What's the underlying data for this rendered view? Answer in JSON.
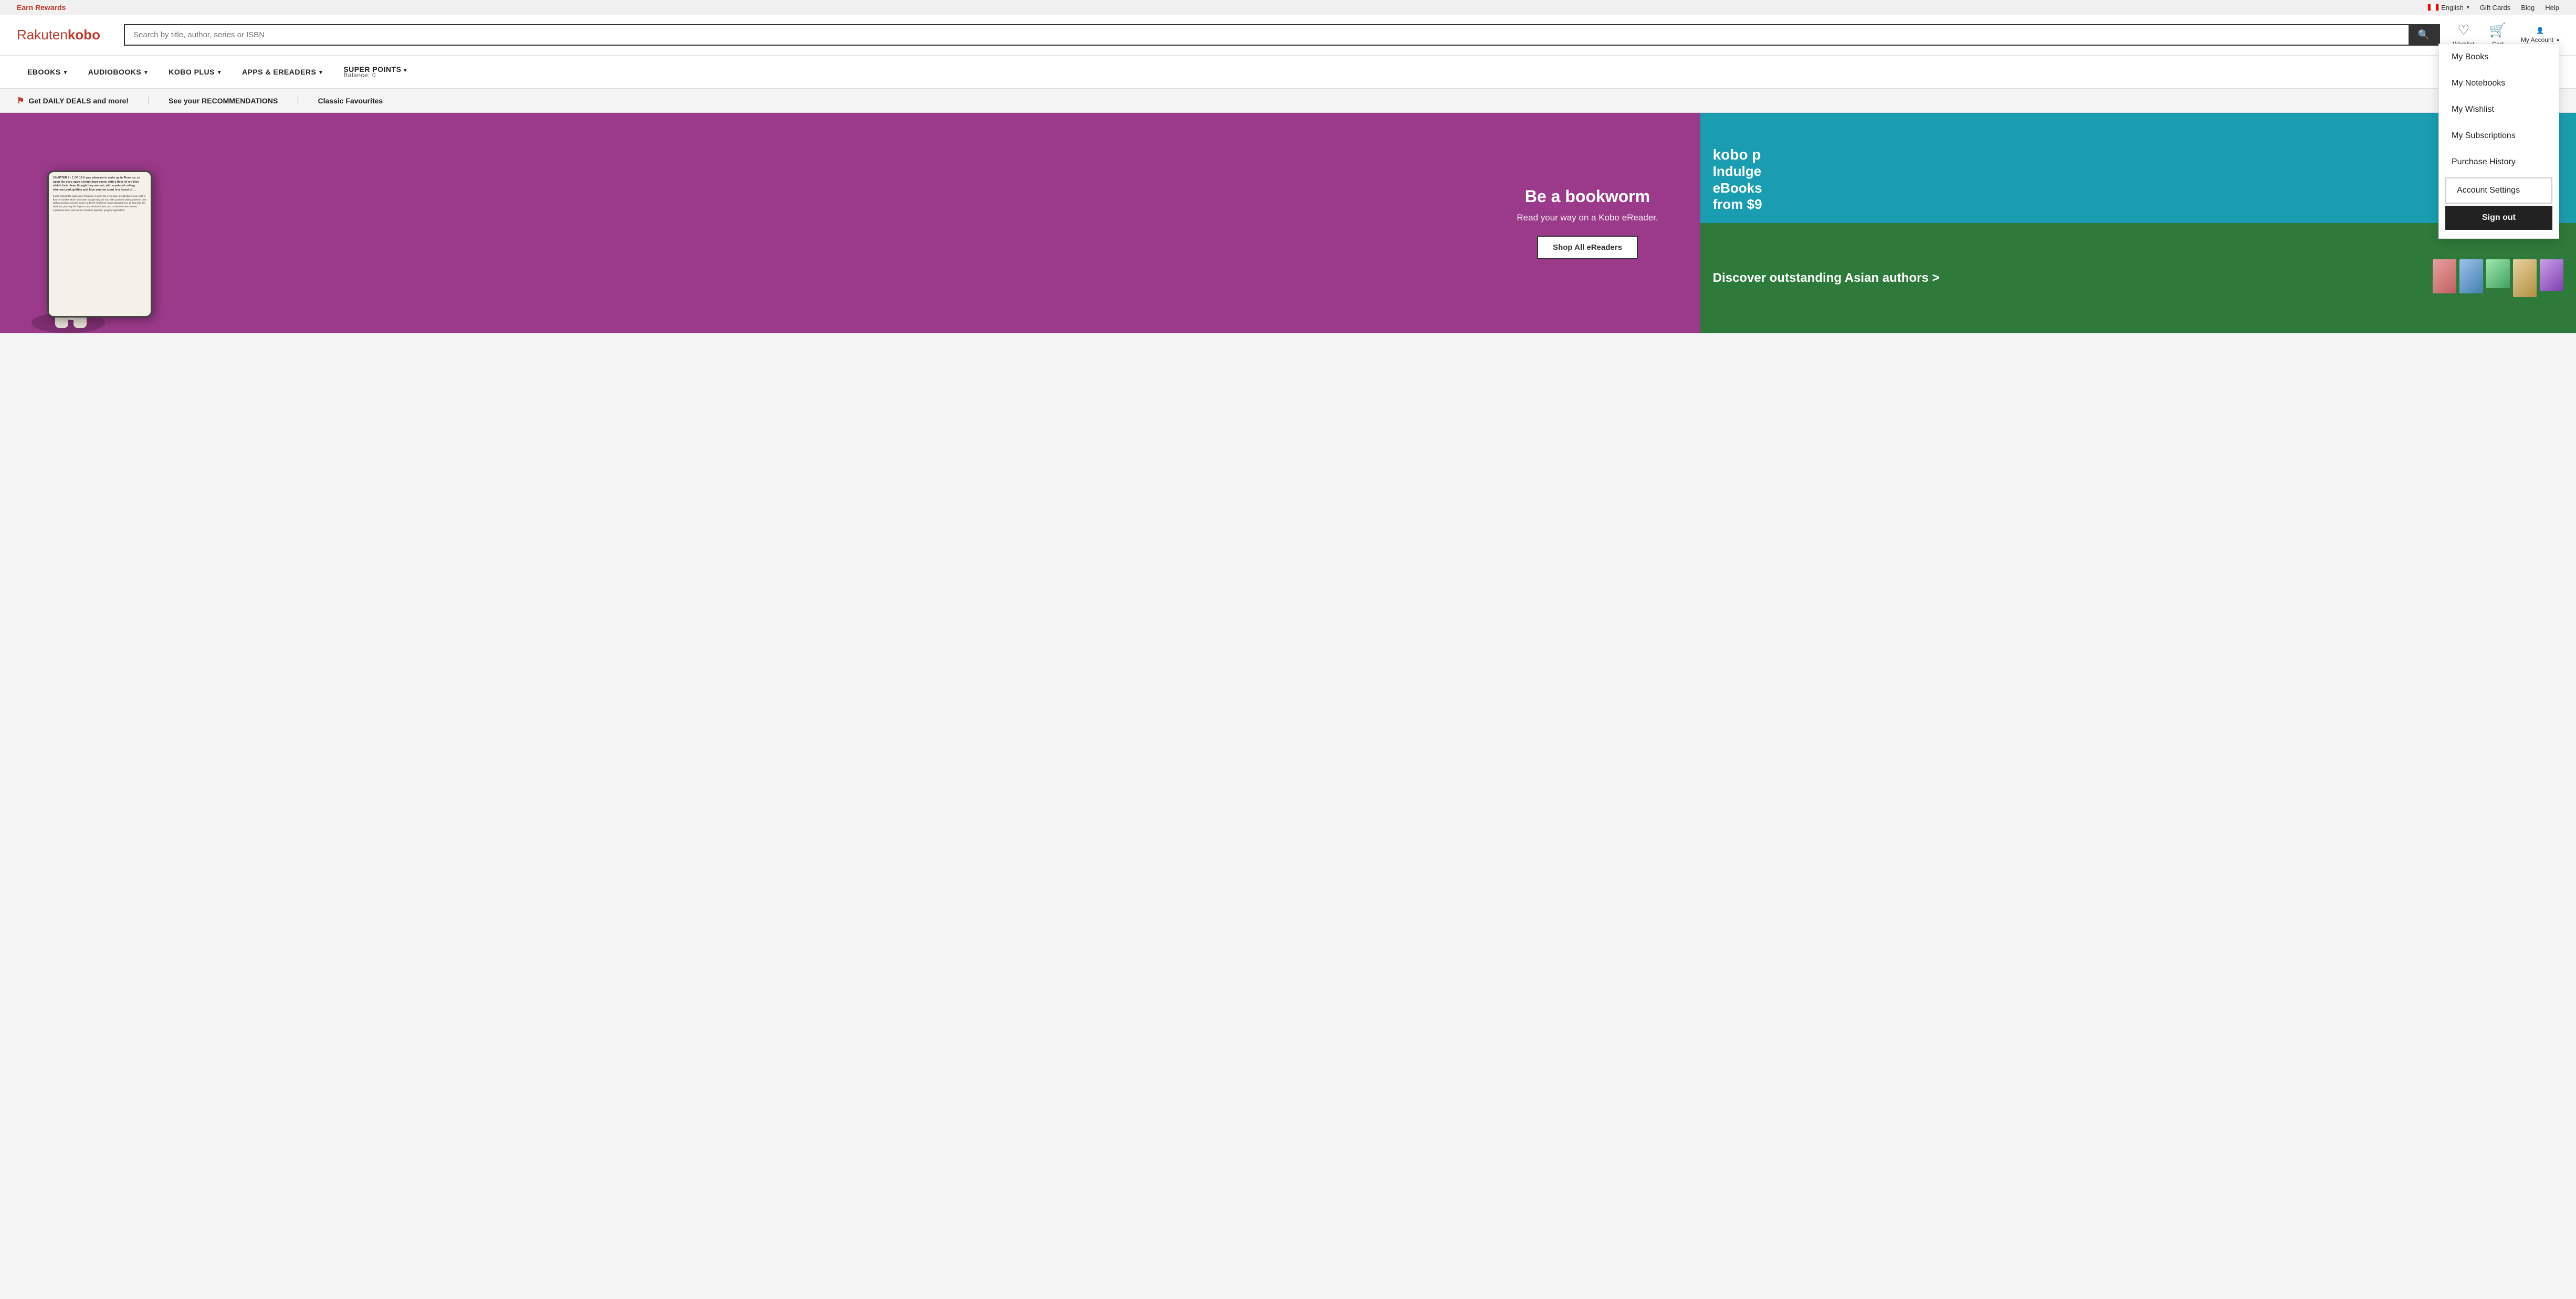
{
  "topBar": {
    "earnRewards": "Earn Rewards",
    "language": "English",
    "giftCards": "Gift Cards",
    "blog": "Blog",
    "help": "Help"
  },
  "header": {
    "logoRakuten": "Rakuten",
    "logoKobo": "kobo",
    "searchPlaceholder": "Search by title, author, series or ISBN",
    "wishlistLabel": "Wishlist",
    "cartLabel": "Cart",
    "myAccountLabel": "My Account"
  },
  "nav": {
    "items": [
      {
        "label": "eBOOKS",
        "hasDropdown": true
      },
      {
        "label": "AUDIOBOOKS",
        "hasDropdown": true
      },
      {
        "label": "KOBO PLUS",
        "hasDropdown": true
      },
      {
        "label": "APPS & eREADERS",
        "hasDropdown": true
      },
      {
        "label": "SUPER POINTS",
        "hasDropdown": true,
        "balance": "Balance: 0"
      }
    ]
  },
  "promoBar": {
    "dailyDeals": "Get DAILY DEALS and more!",
    "recommendations": "See your RECOMMENDATIONS",
    "classicFavourites": "Classic Favourites"
  },
  "hero": {
    "headline": "Be a bookworm",
    "subtext": "Read your way on a Kobo eReader.",
    "ctaLabel": "Shop All eReaders",
    "ereaderText": "CHAPTER 9 · 1 OF 19\n\nIt was pleasant to wake up in Florence, to open the eyes upon a bright bare room, with a floor of red tiles which look clean though they are not; with a painted ceiling whereon pink griffins and blue amorini sport in a forest of ..."
  },
  "heroRightTop": {
    "koboText": "kobo p",
    "line1": "Indulge",
    "line2": "eBooks",
    "line3": "from $9"
  },
  "heroRightBottom": {
    "headline": "Discover outstanding Asian authors >"
  },
  "accountDropdown": {
    "myBooks": "My Books",
    "myNotebooks": "My Notebooks",
    "myWishlist": "My Wishlist",
    "mySubscriptions": "My Subscriptions",
    "purchaseHistory": "Purchase History",
    "accountSettings": "Account Settings",
    "signOut": "Sign out"
  },
  "colors": {
    "brand": "#c0392b",
    "heroPurple": "#9b3a8a",
    "heroTeal": "#1a9db0",
    "heroGreen": "#2d7a3a"
  }
}
